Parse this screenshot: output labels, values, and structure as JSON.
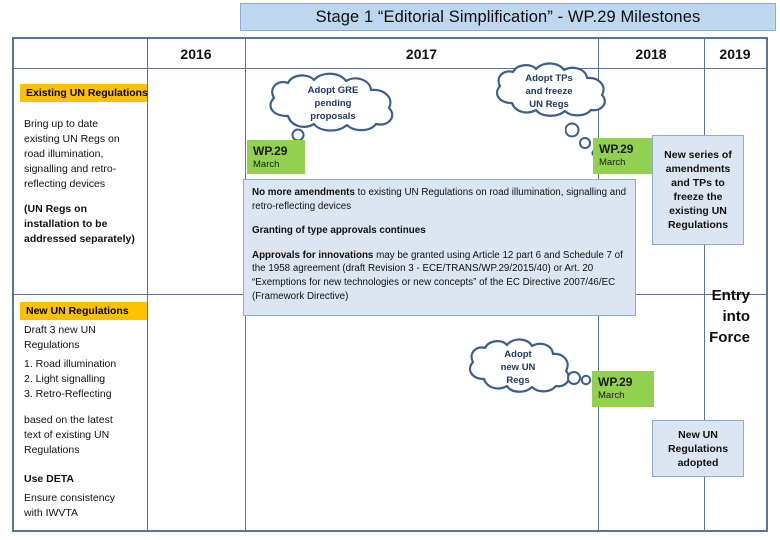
{
  "title": "Stage 1 “Editorial Simplification” -  WP.29 Milestones",
  "colors": {
    "title_bg": "#bdd7ee",
    "grid": "#55779e",
    "tag_bg": "#ffc000",
    "wp_bg": "#92d050",
    "panel_bg": "#dce6f2",
    "panel_border": "#8eaadb",
    "cloud_stroke": "#3c5f8a"
  },
  "timeline": {
    "years": [
      "2016",
      "2017",
      "2018",
      "2019"
    ]
  },
  "left_column": {
    "existing": {
      "tag": "Existing UN Regulations",
      "para1": "Bring up to date\nexisting UN Regs on\nroad illumination,\nsignalling and retro-\nreflecting devices",
      "para2": "(UN Regs on\ninstallation to be\naddressed separately)"
    },
    "new": {
      "tag": "New UN Regulations",
      "para1": "Draft 3 new UN\nRegulations",
      "list": "1. Road illumination\n2. Light signalling\n3. Retro-Reflecting",
      "para2": "based on the latest\ntext of existing UN\nRegulations",
      "para3": "Use DETA",
      "para4": "Ensure consistency\nwith IWVTA"
    }
  },
  "clouds": {
    "gre": "Adopt GRE\npending\nproposals",
    "tps": "Adopt TPs\nand freeze\nUN Regs",
    "new_un": "Adopt\nnew UN\nRegs"
  },
  "milestones": {
    "wp29_2017": {
      "name": "WP.29",
      "month": "March"
    },
    "wp29_2018": {
      "name": "WP.29",
      "month": "March"
    },
    "wp29_new": {
      "name": "WP.29",
      "month": "March"
    }
  },
  "panel": {
    "line1_bold": "No more amendments",
    "line1_rest": " to existing UN Regulations on road illumination, signalling and retro-reflecting devices",
    "line2_bold": "Granting of type approvals continues",
    "line3_bold": "Approvals for innovations",
    "line3_rest": " may be granted using  Article 12 part 6 and Schedule 7 of the 1958 agreement (draft Revision 3 - ECE/TRANS/WP.29/2015/40) or Art. 20 “Exemptions for new technologies or new concepts” of the EC Directive 2007/46/EC (Framework Directive)"
  },
  "right_boxes": {
    "freeze": "New series of amendments and TPs to freeze the existing UN Regulations",
    "entry_into_force": "Entry\ninto\nForce",
    "adopted": "New UN Regulations adopted"
  }
}
